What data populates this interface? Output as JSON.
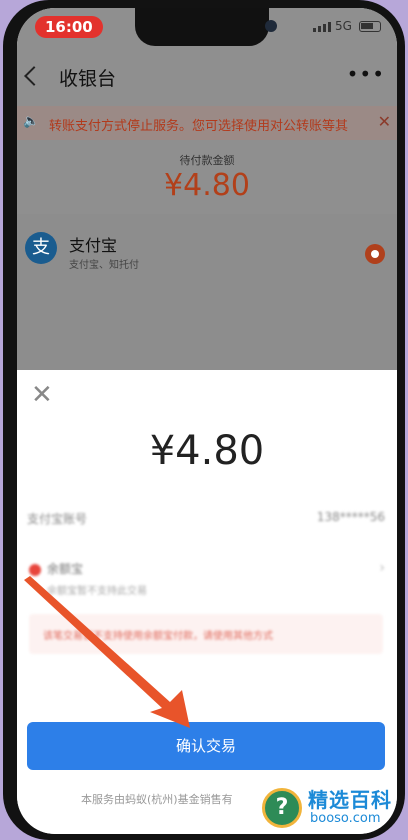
{
  "status_bar": {
    "time": "16:00",
    "network": "5G"
  },
  "header": {
    "title": "收银台",
    "more": "•••"
  },
  "notice": {
    "text": "转账支付方式停止服务。您可选择使用对公转账等其"
  },
  "amount": {
    "label": "待付款金额",
    "value": "¥4.80"
  },
  "payment_method": {
    "name": "支付宝",
    "sub": "支付宝、知托付",
    "logo": "支"
  },
  "sheet": {
    "close": "✕",
    "amount": "¥4.80",
    "account_label": "支付宝账号",
    "account_value": "138*****56",
    "balance_name": "余额宝",
    "balance_sub": "余额宝暂不支持此交易",
    "warning": "该笔交易暂不支持使用余额宝付款，请使用其他方式",
    "confirm_label": "确认交易",
    "footer": "本服务由蚂蚁(杭州)基金销售有"
  },
  "watermark": {
    "title": "精选百科",
    "url": "booso.com",
    "badge": "?"
  },
  "colors": {
    "confirm": "#2d7fe8",
    "amount": "#b2401a",
    "annotation": "#e8542a"
  }
}
